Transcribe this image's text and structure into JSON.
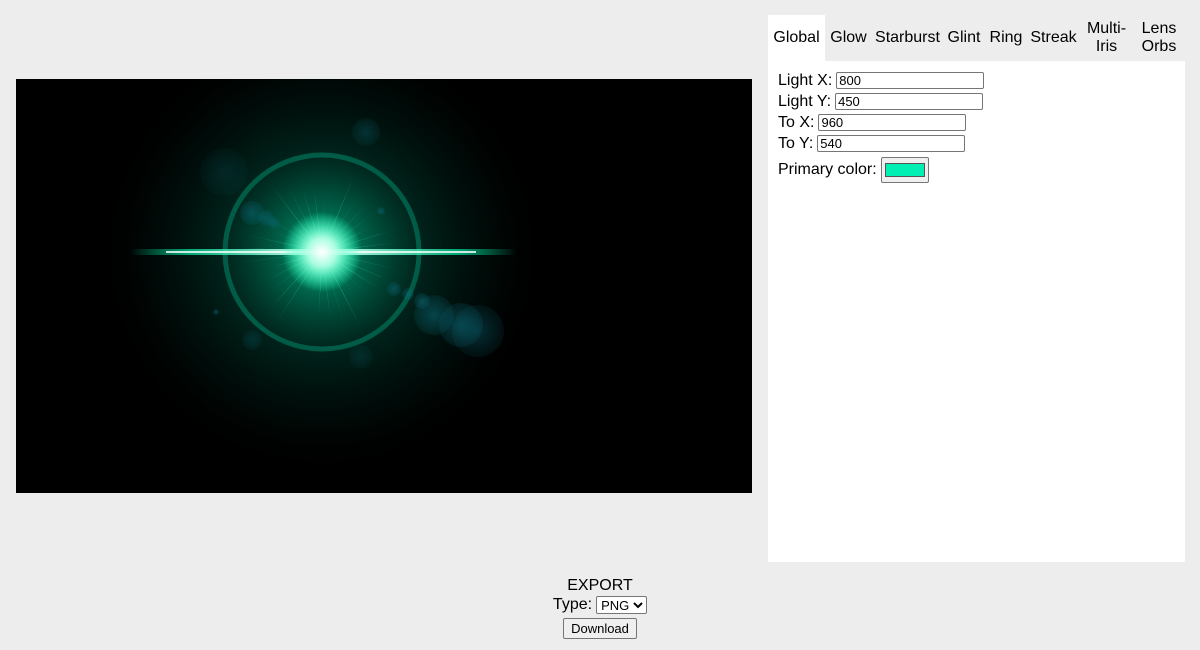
{
  "canvas": {
    "primary_color": "#00e6b4"
  },
  "panel": {
    "tabs": [
      {
        "label": "Global",
        "active": true
      },
      {
        "label": "Glow",
        "active": false
      },
      {
        "label": "Starburst",
        "active": false
      },
      {
        "label": "Glint",
        "active": false
      },
      {
        "label": "Ring",
        "active": false
      },
      {
        "label": "Streak",
        "active": false
      },
      {
        "label": "Multi-\nIris",
        "active": false
      },
      {
        "label": "Lens\nOrbs",
        "active": false
      }
    ],
    "fields": {
      "light_x": {
        "label": "Light X:",
        "value": "800"
      },
      "light_y": {
        "label": "Light Y:",
        "value": "450"
      },
      "to_x": {
        "label": "To X:",
        "value": "960"
      },
      "to_y": {
        "label": "To Y:",
        "value": "540"
      },
      "primary_color": {
        "label": "Primary color:",
        "value": "#00f0b4"
      }
    }
  },
  "export": {
    "title": "EXPORT",
    "type_label": "Type:",
    "type_selected": "PNG",
    "download_label": "Download"
  }
}
